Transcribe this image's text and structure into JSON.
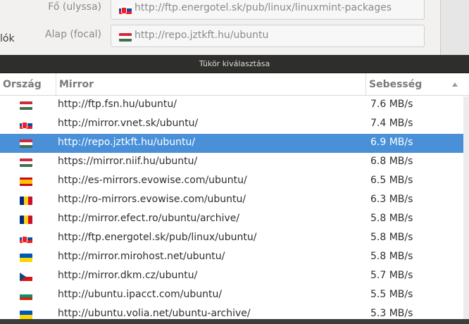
{
  "parent_window": {
    "side_label": "lók",
    "sources": [
      {
        "label": "Fő (ulyssa)",
        "flag": "sk-flag-icon",
        "url": "http://ftp.energotel.sk/pub/linux/linuxmint-packages"
      },
      {
        "label": "Alap (focal)",
        "flag": "hu-flag-icon",
        "url": "http://repo.jztkft.hu/ubuntu"
      }
    ]
  },
  "dialog": {
    "title": "Tükör kiválasztása",
    "columns": {
      "country": "Ország",
      "mirror": "Mirror",
      "speed": "Sebesség"
    },
    "sort_icon": "sort-ascending-icon",
    "selected_index": 2,
    "mirrors": [
      {
        "country": "hu",
        "url": "http://ftp.fsn.hu/ubuntu/",
        "speed": "7.6 MB/s"
      },
      {
        "country": "sk",
        "url": "http://mirror.vnet.sk/ubuntu/",
        "speed": "7.4 MB/s"
      },
      {
        "country": "hu",
        "url": "http://repo.jztkft.hu/ubuntu/",
        "speed": "6.9 MB/s"
      },
      {
        "country": "hu",
        "url": "https://mirror.niif.hu/ubuntu/",
        "speed": "6.8 MB/s"
      },
      {
        "country": "es",
        "url": "http://es-mirrors.evowise.com/ubuntu/",
        "speed": "6.5 MB/s"
      },
      {
        "country": "ro",
        "url": "http://ro-mirrors.evowise.com/ubuntu/",
        "speed": "6.3 MB/s"
      },
      {
        "country": "ro",
        "url": "http://mirror.efect.ro/ubuntu/archive/",
        "speed": "5.8 MB/s"
      },
      {
        "country": "sk",
        "url": "http://ftp.energotel.sk/pub/linux/ubuntu/",
        "speed": "5.8 MB/s"
      },
      {
        "country": "ua",
        "url": "http://mirror.mirohost.net/ubuntu/",
        "speed": "5.8 MB/s"
      },
      {
        "country": "cz",
        "url": "http://mirror.dkm.cz/ubuntu/",
        "speed": "5.7 MB/s"
      },
      {
        "country": "bg",
        "url": "http://ubuntu.ipacct.com/ubuntu/",
        "speed": "5.5 MB/s"
      },
      {
        "country": "ua",
        "url": "http://ubuntu.volia.net/ubuntu-archive/",
        "speed": "5.3 MB/s"
      }
    ]
  },
  "colors": {
    "selection": "#4a90d9",
    "titlebar": "#2e2e2c"
  }
}
